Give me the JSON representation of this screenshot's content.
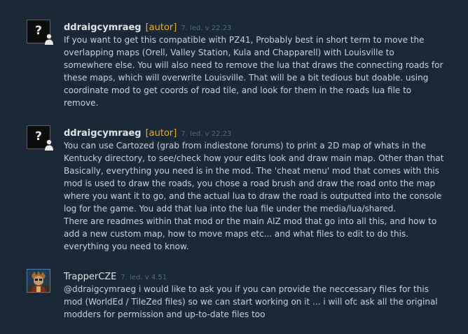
{
  "comments": [
    {
      "author": "ddraigcymraeg",
      "tag": "[autor]",
      "time": "7. led. v 22.23",
      "avatar_icon": "question-mark-avatar",
      "lines": [
        "If you want to get this compatible with PZ41, Probably best in short term to move the",
        "overlapping maps (Orell, Valley Station, Kula and Chapparell) with Louisville to",
        "somewhere else. You will also need to remove the lua that draws the connecting roads for",
        "these maps, which will overwrite Louisville. That will be a bit tedious but doable. using",
        "coordinate mod to get coords of road tile, and look for them in the roads lua file to",
        "remove."
      ]
    },
    {
      "author": "ddraigcymraeg",
      "tag": "[autor]",
      "time": "7. led. v 22.23",
      "avatar_icon": "question-mark-avatar",
      "lines": [
        "You can use Cartozed (grab from indiestone forums) to print a 2D map of whats in the",
        "Kentucky directory, to see/check how your edits look and draw main map. Other than that",
        "Basically, everything you need is in the mod. The 'cheat menu' mod that comes with this",
        "mod is used to draw the roads, you chose a road brush and draw the road onto the map",
        "where you want it to go, and the actual lua to draw the road is outputted into the console",
        "log for the game. You add that lua into the lua file under the media/lua/shared.",
        "There are readmes within that mod or the main AIZ mod that go into all this, and how to",
        "add a new custom map, how to move maps etc... and what files to edit to do this.",
        "everything you need to know."
      ]
    },
    {
      "author": "TrapperCZE",
      "time": "7. led. v 4.51",
      "avatar_icon": "character-portrait-avatar",
      "lines": [
        "@ddraigcymraeg i would like to ask you if you can provide the neccessary files for this",
        "mod (WorldEd / TileZed files) so we can start working on it ... i will ofc ask all the original",
        "modders for permission and up-to-date files too"
      ]
    }
  ],
  "colors": {
    "background": "#1b2838",
    "author": "#dfe3e6",
    "tag": "#e5b12d",
    "time": "#4f6e8a",
    "body": "#c6d4df"
  }
}
